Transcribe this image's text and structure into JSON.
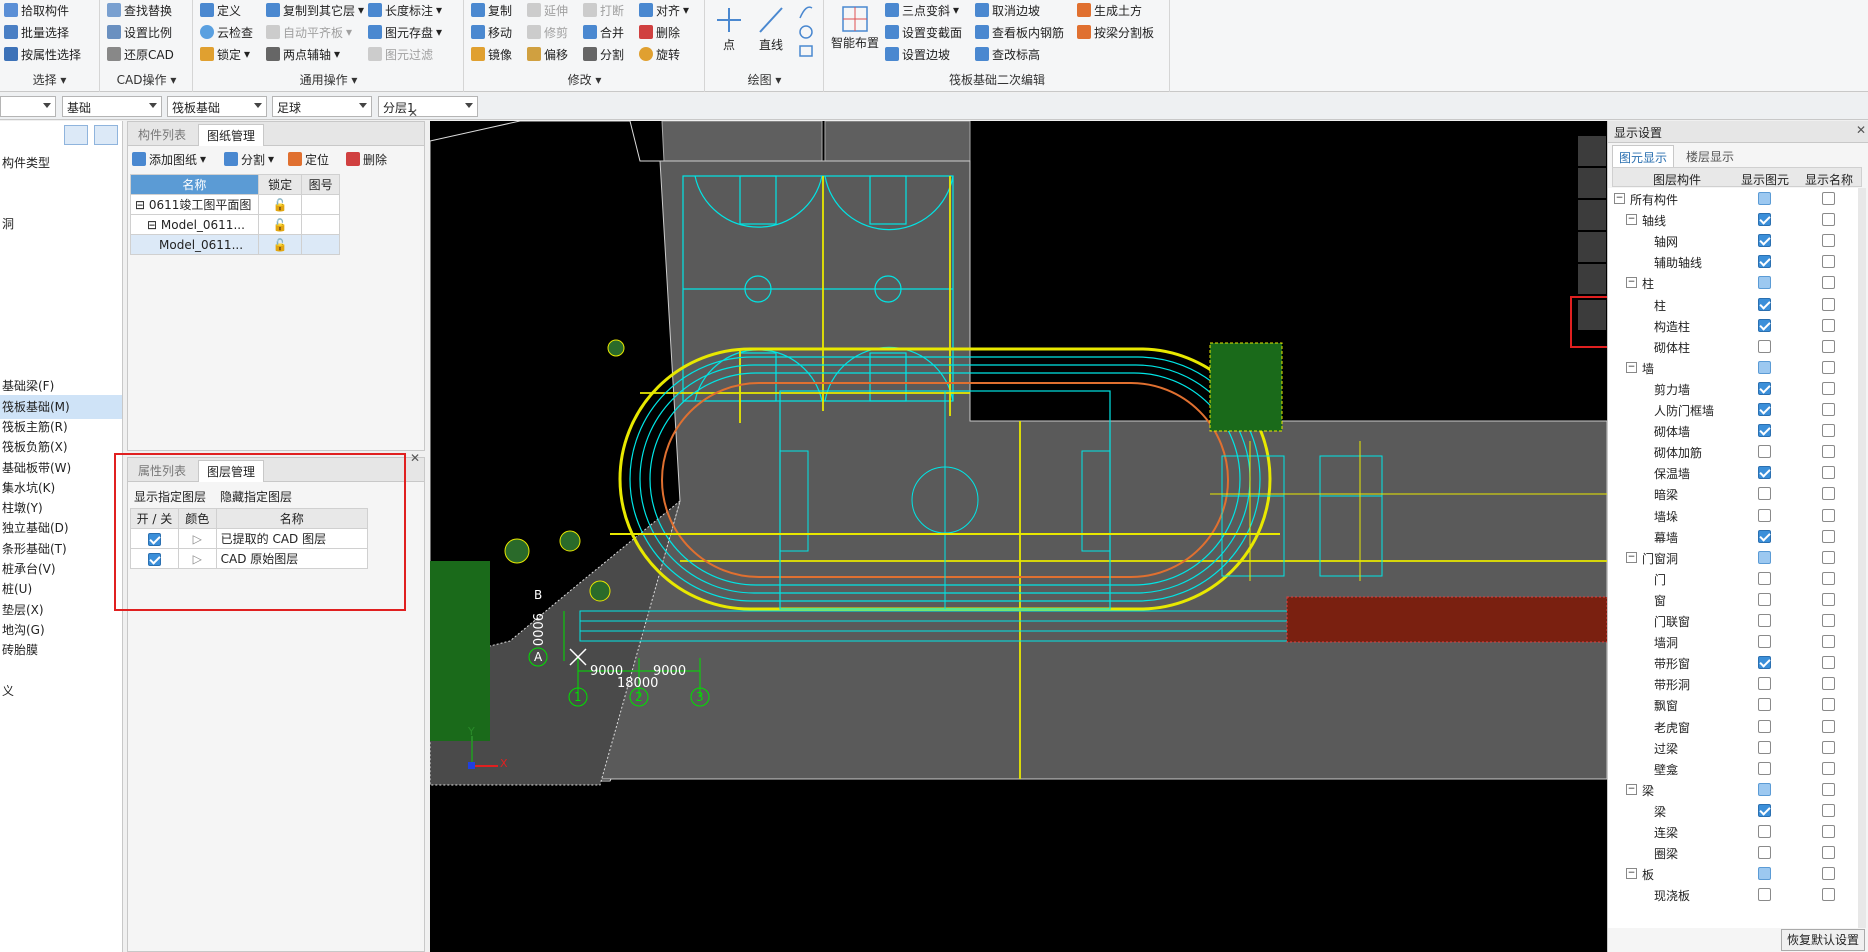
{
  "ribbon": {
    "select": {
      "items": [
        "拾取构件",
        "批量选择",
        "按属性选择"
      ],
      "label": "选择"
    },
    "cad": {
      "items": [
        "查找替换",
        "设置比例",
        "还原CAD"
      ],
      "label": "CAD操作"
    },
    "general": {
      "items": [
        "定义",
        "云检查",
        "锁定",
        "复制到其它层",
        "自动平齐板",
        "两点辅轴",
        "长度标注",
        "图元存盘",
        "图元过滤"
      ],
      "label": "通用操作"
    },
    "modify": {
      "items": [
        "复制",
        "移动",
        "镜像",
        "延伸",
        "修剪",
        "偏移",
        "打断",
        "合并",
        "分割",
        "对齐",
        "删除",
        "旋转"
      ],
      "label": "修改"
    },
    "draw": {
      "items": [
        "点",
        "直线"
      ],
      "label": "绘图"
    },
    "raft": {
      "items": [
        "智能布置",
        "三点变斜",
        "设置变截面",
        "设置边坡",
        "取消边坡",
        "查看板内钢筋",
        "查改标高",
        "生成土方",
        "按梁分割板"
      ],
      "label": "筏板基础二次编辑"
    }
  },
  "combos": [
    "",
    "基础",
    "筏板基础",
    "足球",
    "分层1"
  ],
  "leftnav": {
    "items": [
      "构件类型",
      "",
      "",
      "洞",
      "",
      "",
      "",
      "",
      "",
      "",
      "",
      "基础梁(F)",
      "筏板基础(M)",
      "筏板主筋(R)",
      "筏板负筋(X)",
      "基础板带(W)",
      "集水坑(K)",
      "柱墩(Y)",
      "独立基础(D)",
      "条形基础(T)",
      "桩承台(V)",
      "桩(U)",
      "垫层(X)",
      "地沟(G)",
      "砖胎膜",
      "",
      "义"
    ],
    "selected": "筏板基础(M)"
  },
  "drawing_panel": {
    "tabs": [
      "构件列表",
      "图纸管理"
    ],
    "toolbar": [
      "添加图纸",
      "分割",
      "定位",
      "删除"
    ],
    "headers": [
      "名称",
      "锁定",
      "图号"
    ],
    "rows": [
      {
        "name": "0611竣工图平面图",
        "indent": 0
      },
      {
        "name": "Model_0611...",
        "indent": 1
      },
      {
        "name": "Model_0611...",
        "indent": 2
      }
    ]
  },
  "layer_panel": {
    "tabs": [
      "属性列表",
      "图层管理"
    ],
    "actions": [
      "显示指定图层",
      "隐藏指定图层"
    ],
    "headers": [
      "开 / 关",
      "颜色",
      "名称"
    ],
    "rows": [
      {
        "name": "已提取的 CAD 图层",
        "on": true
      },
      {
        "name": "CAD 原始图层",
        "on": true
      }
    ]
  },
  "canvas": {
    "dims": [
      "9000",
      "9000",
      "18000",
      "9000"
    ],
    "axis_numbers": [
      "1",
      "2",
      "3"
    ],
    "axis_letters": [
      "A",
      "B"
    ],
    "ucs": {
      "x": "X",
      "y": "Y"
    }
  },
  "display_settings": {
    "title": "显示设置",
    "tabs": [
      "图元显示",
      "楼层显示"
    ],
    "headers": [
      "图层构件",
      "显示图元",
      "显示名称"
    ],
    "rows": [
      {
        "name": "所有构件",
        "level": 0,
        "group": true,
        "show": "part",
        "label": false
      },
      {
        "name": "轴线",
        "level": 1,
        "group": true,
        "show": true,
        "label": false
      },
      {
        "name": "轴网",
        "level": 2,
        "group": false,
        "show": true,
        "label": false
      },
      {
        "name": "辅助轴线",
        "level": 2,
        "group": false,
        "show": true,
        "label": false
      },
      {
        "name": "柱",
        "level": 1,
        "group": true,
        "show": "part",
        "label": false
      },
      {
        "name": "柱",
        "level": 2,
        "group": false,
        "show": true,
        "label": false
      },
      {
        "name": "构造柱",
        "level": 2,
        "group": false,
        "show": true,
        "label": false
      },
      {
        "name": "砌体柱",
        "level": 2,
        "group": false,
        "show": false,
        "label": false
      },
      {
        "name": "墙",
        "level": 1,
        "group": true,
        "show": "part",
        "label": false
      },
      {
        "name": "剪力墙",
        "level": 2,
        "group": false,
        "show": true,
        "label": false
      },
      {
        "name": "人防门框墙",
        "level": 2,
        "group": false,
        "show": true,
        "label": false
      },
      {
        "name": "砌体墙",
        "level": 2,
        "group": false,
        "show": true,
        "label": false
      },
      {
        "name": "砌体加筋",
        "level": 2,
        "group": false,
        "show": false,
        "label": false
      },
      {
        "name": "保温墙",
        "level": 2,
        "group": false,
        "show": true,
        "label": false
      },
      {
        "name": "暗梁",
        "level": 2,
        "group": false,
        "show": false,
        "label": false
      },
      {
        "name": "墙垛",
        "level": 2,
        "group": false,
        "show": false,
        "label": false
      },
      {
        "name": "幕墙",
        "level": 2,
        "group": false,
        "show": true,
        "label": false
      },
      {
        "name": "门窗洞",
        "level": 1,
        "group": true,
        "show": "part",
        "label": false
      },
      {
        "name": "门",
        "level": 2,
        "group": false,
        "show": false,
        "label": false
      },
      {
        "name": "窗",
        "level": 2,
        "group": false,
        "show": false,
        "label": false
      },
      {
        "name": "门联窗",
        "level": 2,
        "group": false,
        "show": false,
        "label": false
      },
      {
        "name": "墙洞",
        "level": 2,
        "group": false,
        "show": false,
        "label": false
      },
      {
        "name": "带形窗",
        "level": 2,
        "group": false,
        "show": true,
        "label": false
      },
      {
        "name": "带形洞",
        "level": 2,
        "group": false,
        "show": false,
        "label": false
      },
      {
        "name": "飘窗",
        "level": 2,
        "group": false,
        "show": false,
        "label": false
      },
      {
        "name": "老虎窗",
        "level": 2,
        "group": false,
        "show": false,
        "label": false
      },
      {
        "name": "过梁",
        "level": 2,
        "group": false,
        "show": false,
        "label": false
      },
      {
        "name": "壁龛",
        "level": 2,
        "group": false,
        "show": false,
        "label": false
      },
      {
        "name": "梁",
        "level": 1,
        "group": true,
        "show": "part",
        "label": false
      },
      {
        "name": "梁",
        "level": 2,
        "group": false,
        "show": true,
        "label": false
      },
      {
        "name": "连梁",
        "level": 2,
        "group": false,
        "show": false,
        "label": false
      },
      {
        "name": "圈梁",
        "level": 2,
        "group": false,
        "show": false,
        "label": false
      },
      {
        "name": "板",
        "level": 1,
        "group": true,
        "show": "part",
        "label": false
      },
      {
        "name": "现浇板",
        "level": 2,
        "group": false,
        "show": false,
        "label": false
      }
    ],
    "restore_button": "恢复默认设置"
  }
}
